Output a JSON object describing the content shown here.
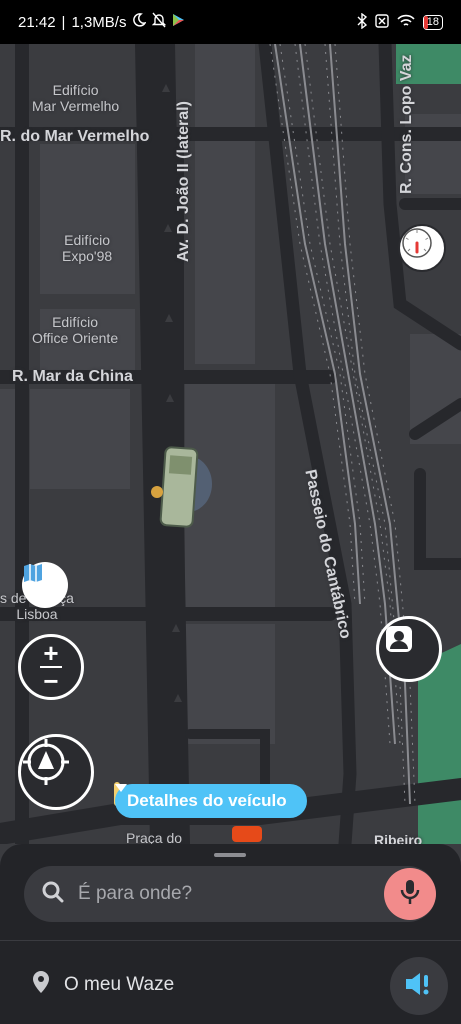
{
  "status_bar": {
    "time": "21:42",
    "network_speed": "1,3MB/s",
    "icons_left": [
      "moon-icon",
      "bell-off-icon",
      "play-store-icon"
    ],
    "icons_right": [
      "bluetooth-icon",
      "no-sim-icon",
      "wifi-icon",
      "battery-icon"
    ],
    "battery_level": "18"
  },
  "map": {
    "street_labels": {
      "mar_vermelho": "R. do Mar Vermelho",
      "joao_ii": "Av. D. João II (lateral)",
      "cons_lopo_vaz": "R. Cons. Lopo Vaz",
      "mar_da_china": "R. Mar da China",
      "passeio_cantabrico": "Passeio do Cantábrico",
      "praca_do": "Praça do",
      "ribeiro": "Ribeiro"
    },
    "building_labels": {
      "mar_vermelho_l1": "Edifício",
      "mar_vermelho_l2": "Mar Vermelho",
      "expo_l1": "Edifício",
      "expo_l2": "Expo'98",
      "oriente_l1": "Edifício",
      "oriente_l2": "Office Oriente",
      "justica_l1": "s de Justiça",
      "justica_l2": "Lisboa"
    },
    "colors": {
      "background": "#3b3c40",
      "road": "#27282c",
      "park": "#3e8a66",
      "accent": "#4fc3f7"
    }
  },
  "controls": {
    "layers_icon": "map-icon",
    "zoom_in": "+",
    "zoom_out": "−",
    "recenter_icon": "compass-icon",
    "speedometer_icon": "speedometer-icon",
    "report_icon": "person-icon"
  },
  "vehicle_details": {
    "label": "Detalhes do veículo"
  },
  "bottom_sheet": {
    "search_placeholder": "É para onde?",
    "my_waze": "O meu Waze"
  }
}
